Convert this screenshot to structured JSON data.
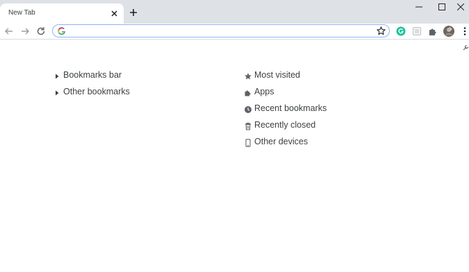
{
  "tab": {
    "title": "New Tab"
  },
  "omnibox": {
    "value": ""
  },
  "bookmarks_left": [
    {
      "label": "Bookmarks bar"
    },
    {
      "label": "Other bookmarks"
    }
  ],
  "bookmarks_right": [
    {
      "label": "Most visited",
      "icon": "star-icon"
    },
    {
      "label": "Apps",
      "icon": "puzzle-icon"
    },
    {
      "label": "Recent bookmarks",
      "icon": "clock-icon"
    },
    {
      "label": "Recently closed",
      "icon": "trash-icon"
    },
    {
      "label": "Other devices",
      "icon": "phone-icon"
    }
  ],
  "colors": {
    "tabstrip": "#dee1e6",
    "omnibox_border": "#8ab4f8",
    "grammarly": "#15c39a",
    "text": "#3c4043"
  }
}
